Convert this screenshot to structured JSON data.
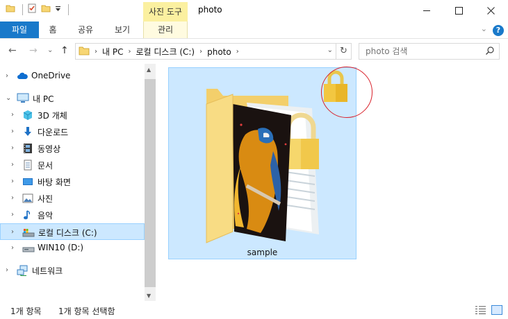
{
  "window": {
    "title": "photo",
    "tool_tab": "사진 도구",
    "controls": {
      "minimize": "—",
      "maximize": "☐",
      "close": "✕"
    }
  },
  "ribbon": {
    "tabs": [
      "파일",
      "홈",
      "공유",
      "보기"
    ],
    "tool_sub_tab": "관리",
    "help": "?",
    "collapse": "⌄",
    "file_tab_color": "#1979ca",
    "tool_tab_color": "#fbf0a0"
  },
  "nav": {
    "back": "←",
    "forward": "→",
    "recent": "⌄",
    "up": "↑",
    "breadcrumb": [
      "내 PC",
      "로컬 디스크 (C:)",
      "photo"
    ],
    "address_dropdown": "⌄",
    "refresh": "↻",
    "search_placeholder": "photo 검색"
  },
  "sidebar": {
    "items": [
      {
        "label": "OneDrive",
        "icon": "cloud-icon",
        "expand": "›",
        "indent": false
      },
      {
        "label": "내 PC",
        "icon": "computer-icon",
        "expand": "⌄",
        "indent": false
      },
      {
        "label": "3D 개체",
        "icon": "cube-3d-icon",
        "expand": "›",
        "indent": true
      },
      {
        "label": "다운로드",
        "icon": "download-arrow-icon",
        "expand": "›",
        "indent": true
      },
      {
        "label": "동영상",
        "icon": "film-icon",
        "expand": "›",
        "indent": true
      },
      {
        "label": "문서",
        "icon": "document-icon",
        "expand": "›",
        "indent": true
      },
      {
        "label": "바탕 화면",
        "icon": "desktop-icon",
        "expand": "›",
        "indent": true
      },
      {
        "label": "사진",
        "icon": "picture-icon",
        "expand": "›",
        "indent": true
      },
      {
        "label": "음악",
        "icon": "music-note-icon",
        "expand": "›",
        "indent": true
      },
      {
        "label": "로컬 디스크 (C:)",
        "icon": "local-disk-icon",
        "expand": "›",
        "indent": true,
        "selected": true
      },
      {
        "label": "WIN10 (D:)",
        "icon": "drive-icon",
        "expand": "›",
        "indent": true
      },
      {
        "label": "네트워크",
        "icon": "network-icon",
        "expand": "›",
        "indent": false
      }
    ]
  },
  "content": {
    "items": [
      {
        "name": "sample",
        "icon": "locked-photo-folder-icon",
        "selected": true
      }
    ],
    "annotation": "lock-icon highlighted with red circle"
  },
  "status": {
    "item_count": "1개 항목",
    "selected_count": "1개 항목 선택함"
  }
}
